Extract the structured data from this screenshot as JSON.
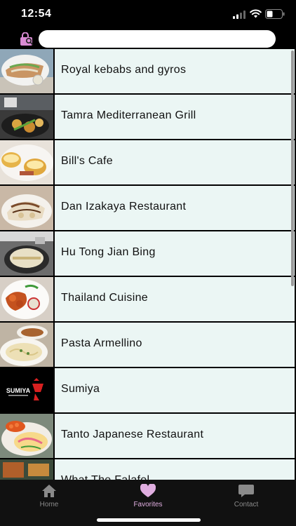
{
  "status": {
    "time": "12:54"
  },
  "search": {
    "value": "",
    "placeholder": ""
  },
  "restaurants": [
    {
      "name": "Royal kebabs and gyros"
    },
    {
      "name": "Tamra Mediterranean Grill"
    },
    {
      "name": "Bill's Cafe"
    },
    {
      "name": "Dan Izakaya Restaurant"
    },
    {
      "name": "Hu Tong Jian Bing"
    },
    {
      "name": "Thailand Cuisine"
    },
    {
      "name": "Pasta Armellino"
    },
    {
      "name": "Sumiya"
    },
    {
      "name": "Tanto Japanese Restaurant"
    },
    {
      "name": "What The Falafel"
    }
  ],
  "sumiya_logo": {
    "text": "SUMIYA"
  },
  "tabs": [
    {
      "label": "Home",
      "icon": "home-icon"
    },
    {
      "label": "Favorites",
      "icon": "heart-icon",
      "active": true
    },
    {
      "label": "Contact",
      "icon": "chat-icon"
    }
  ],
  "colors": {
    "cell_bg": "#ebf6f4",
    "active_tab": "#e0aee0",
    "accent_icon": "#d98bd4"
  }
}
